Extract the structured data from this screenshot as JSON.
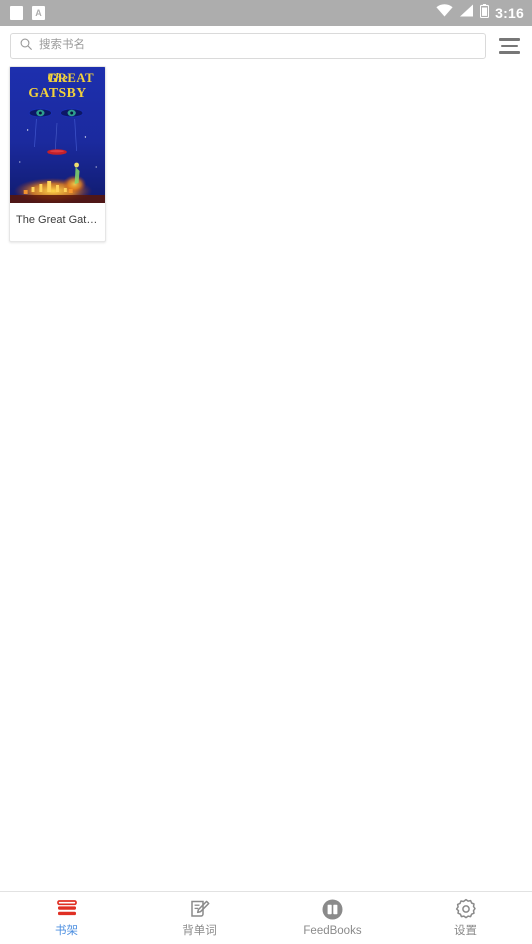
{
  "statusbar": {
    "notification_icon": "square-notification-icon",
    "app_badge_icon": "a-badge-icon",
    "app_badge_text": "A",
    "wifi_icon": "wifi-icon",
    "signal_icon": "cellular-signal-icon",
    "battery_icon": "battery-icon",
    "time": "3:16"
  },
  "search": {
    "icon": "search-icon",
    "placeholder": "搜索书名",
    "value": ""
  },
  "menu": {
    "icon": "hamburger-menu-icon"
  },
  "shelf": {
    "books": [
      {
        "title": "The Great Gatsby",
        "cover_title_line1": "The GREAT",
        "cover_title_line2": "GATSBY",
        "cover_bg": "#1b2a9e",
        "cover_title_color": "#f2d23c"
      }
    ]
  },
  "bottom_nav": {
    "tabs": [
      {
        "label": "书架",
        "icon": "books-stack-icon",
        "active": true,
        "color": "#e03024"
      },
      {
        "label": "背单词",
        "icon": "note-pencil-icon",
        "active": false,
        "color": "#8a8a8a"
      },
      {
        "label": "FeedBooks",
        "icon": "open-book-circle-icon",
        "active": false,
        "color": "#8a8a8a"
      },
      {
        "label": "设置",
        "icon": "gear-icon",
        "active": false,
        "color": "#8a8a8a"
      }
    ],
    "active_color": "#4d8fe0",
    "inactive_color": "#8a8a8a"
  }
}
